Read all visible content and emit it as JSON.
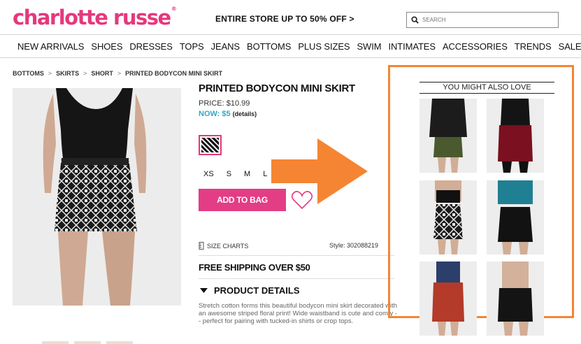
{
  "header": {
    "logo": "charlotte russe",
    "logo_mark": "®",
    "promo": "ENTIRE STORE UP TO 50% OFF >",
    "search_placeholder": "SEARCH",
    "search_icon": "search-icon"
  },
  "nav": {
    "items": [
      "NEW ARRIVALS",
      "SHOES",
      "DRESSES",
      "TOPS",
      "JEANS",
      "BOTTOMS",
      "PLUS SIZES",
      "SWIM",
      "INTIMATES",
      "ACCESSORIES",
      "TRENDS",
      "SALE"
    ]
  },
  "breadcrumb": [
    "BOTTOMS",
    "SKIRTS",
    "SHORT",
    "PRINTED BODYCON MINI SKIRT"
  ],
  "breadcrumb_sep": ">",
  "product": {
    "title": "PRINTED BODYCON MINI SKIRT",
    "price": "PRICE: $10.99",
    "now": "NOW: $5",
    "details_link": "(details)",
    "sizes": [
      "XS",
      "S",
      "M",
      "L"
    ],
    "add_to_bag": "ADD TO BAG",
    "size_charts": "SIZE CHARTS",
    "style": "Style: 302088219",
    "shipping": "FREE SHIPPING OVER $50",
    "details_heading": "PRODUCT DETAILS",
    "description": "Stretch cotton forms this beautiful bodycon mini skirt decorated with an awesome striped floral print! Wide waistband is cute and comfy -- perfect for pairing with tucked-in shirts or crop tops."
  },
  "recommendations": {
    "heading": "YOU MIGHT ALSO LOVE"
  },
  "colors": {
    "brand": "#e5387d",
    "now_price": "#35a6c8",
    "highlight": "#f58532"
  }
}
